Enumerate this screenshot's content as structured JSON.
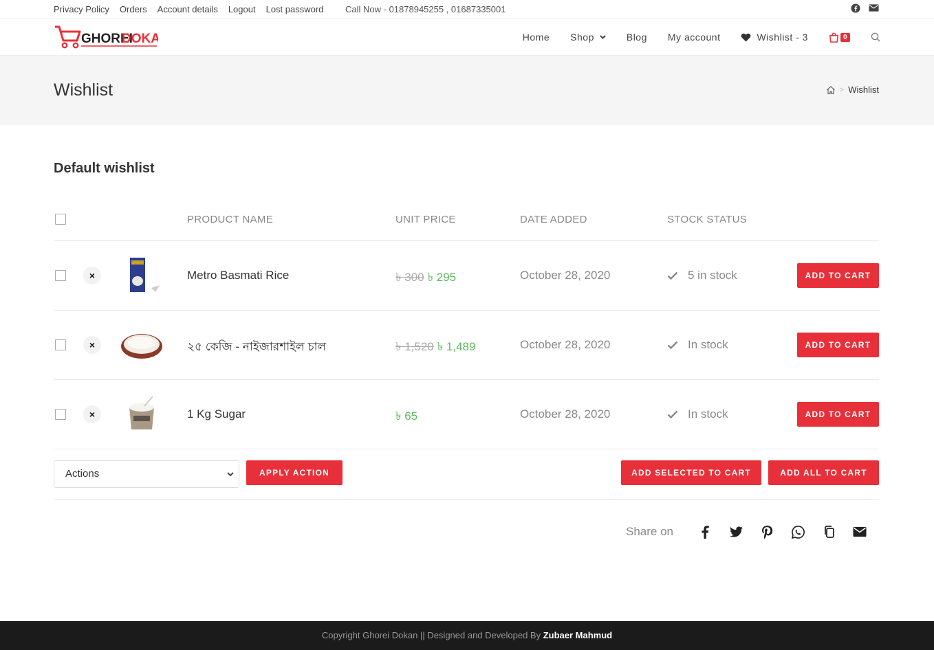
{
  "topbar": {
    "links": [
      "Privacy Policy",
      "Orders",
      "Account details",
      "Logout",
      "Lost password"
    ],
    "call": "Call Now - 01878945255 , 01687335001",
    "social": [
      "facebook-icon",
      "envelope-icon"
    ]
  },
  "header": {
    "logo_text_1": "GHOREI",
    "logo_text_2": "DOKAN",
    "nav": {
      "home": "Home",
      "shop": "Shop",
      "blog": "Blog",
      "account": "My account",
      "wishlist": "Wishlist - 3",
      "cart_count": "0"
    }
  },
  "page": {
    "title": "Wishlist",
    "breadcrumb": "Wishlist"
  },
  "wishlist": {
    "heading": "Default wishlist",
    "columns": {
      "product": "PRODUCT NAME",
      "price": "UNIT PRICE",
      "date": "DATE ADDED",
      "stock": "STOCK STATUS"
    },
    "items": [
      {
        "name": "Metro Basmati Rice",
        "old_price": "৳ 300",
        "price": "৳ 295",
        "date": "October 28, 2020",
        "stock": "5 in stock",
        "button": "ADD TO CART"
      },
      {
        "name": "২৫ কেজি - নাইজারশাইল চাল",
        "old_price": "৳ 1,520",
        "price": "৳ 1,489",
        "date": "October 28, 2020",
        "stock": "In stock",
        "button": "ADD TO CART"
      },
      {
        "name": "1 Kg Sugar",
        "old_price": "",
        "price": "৳ 65",
        "date": "October 28, 2020",
        "stock": "In stock",
        "button": "ADD TO CART"
      }
    ],
    "actions_select": "Actions",
    "apply_action": "APPLY ACTION",
    "add_selected": "ADD SELECTED TO CART",
    "add_all": "ADD ALL TO CART",
    "share_label": "Share on",
    "share_icons": [
      "facebook-icon",
      "twitter-icon",
      "pinterest-icon",
      "whatsapp-icon",
      "copy-icon",
      "email-icon"
    ]
  },
  "footer": {
    "text": "Copyright Ghorei Dokan || Designed and Developed By ",
    "author": "Zubaer Mahmud"
  },
  "colors": {
    "accent": "#e8303a",
    "sale_price": "#5cb85c",
    "footer_bg": "#1b1b1b"
  }
}
